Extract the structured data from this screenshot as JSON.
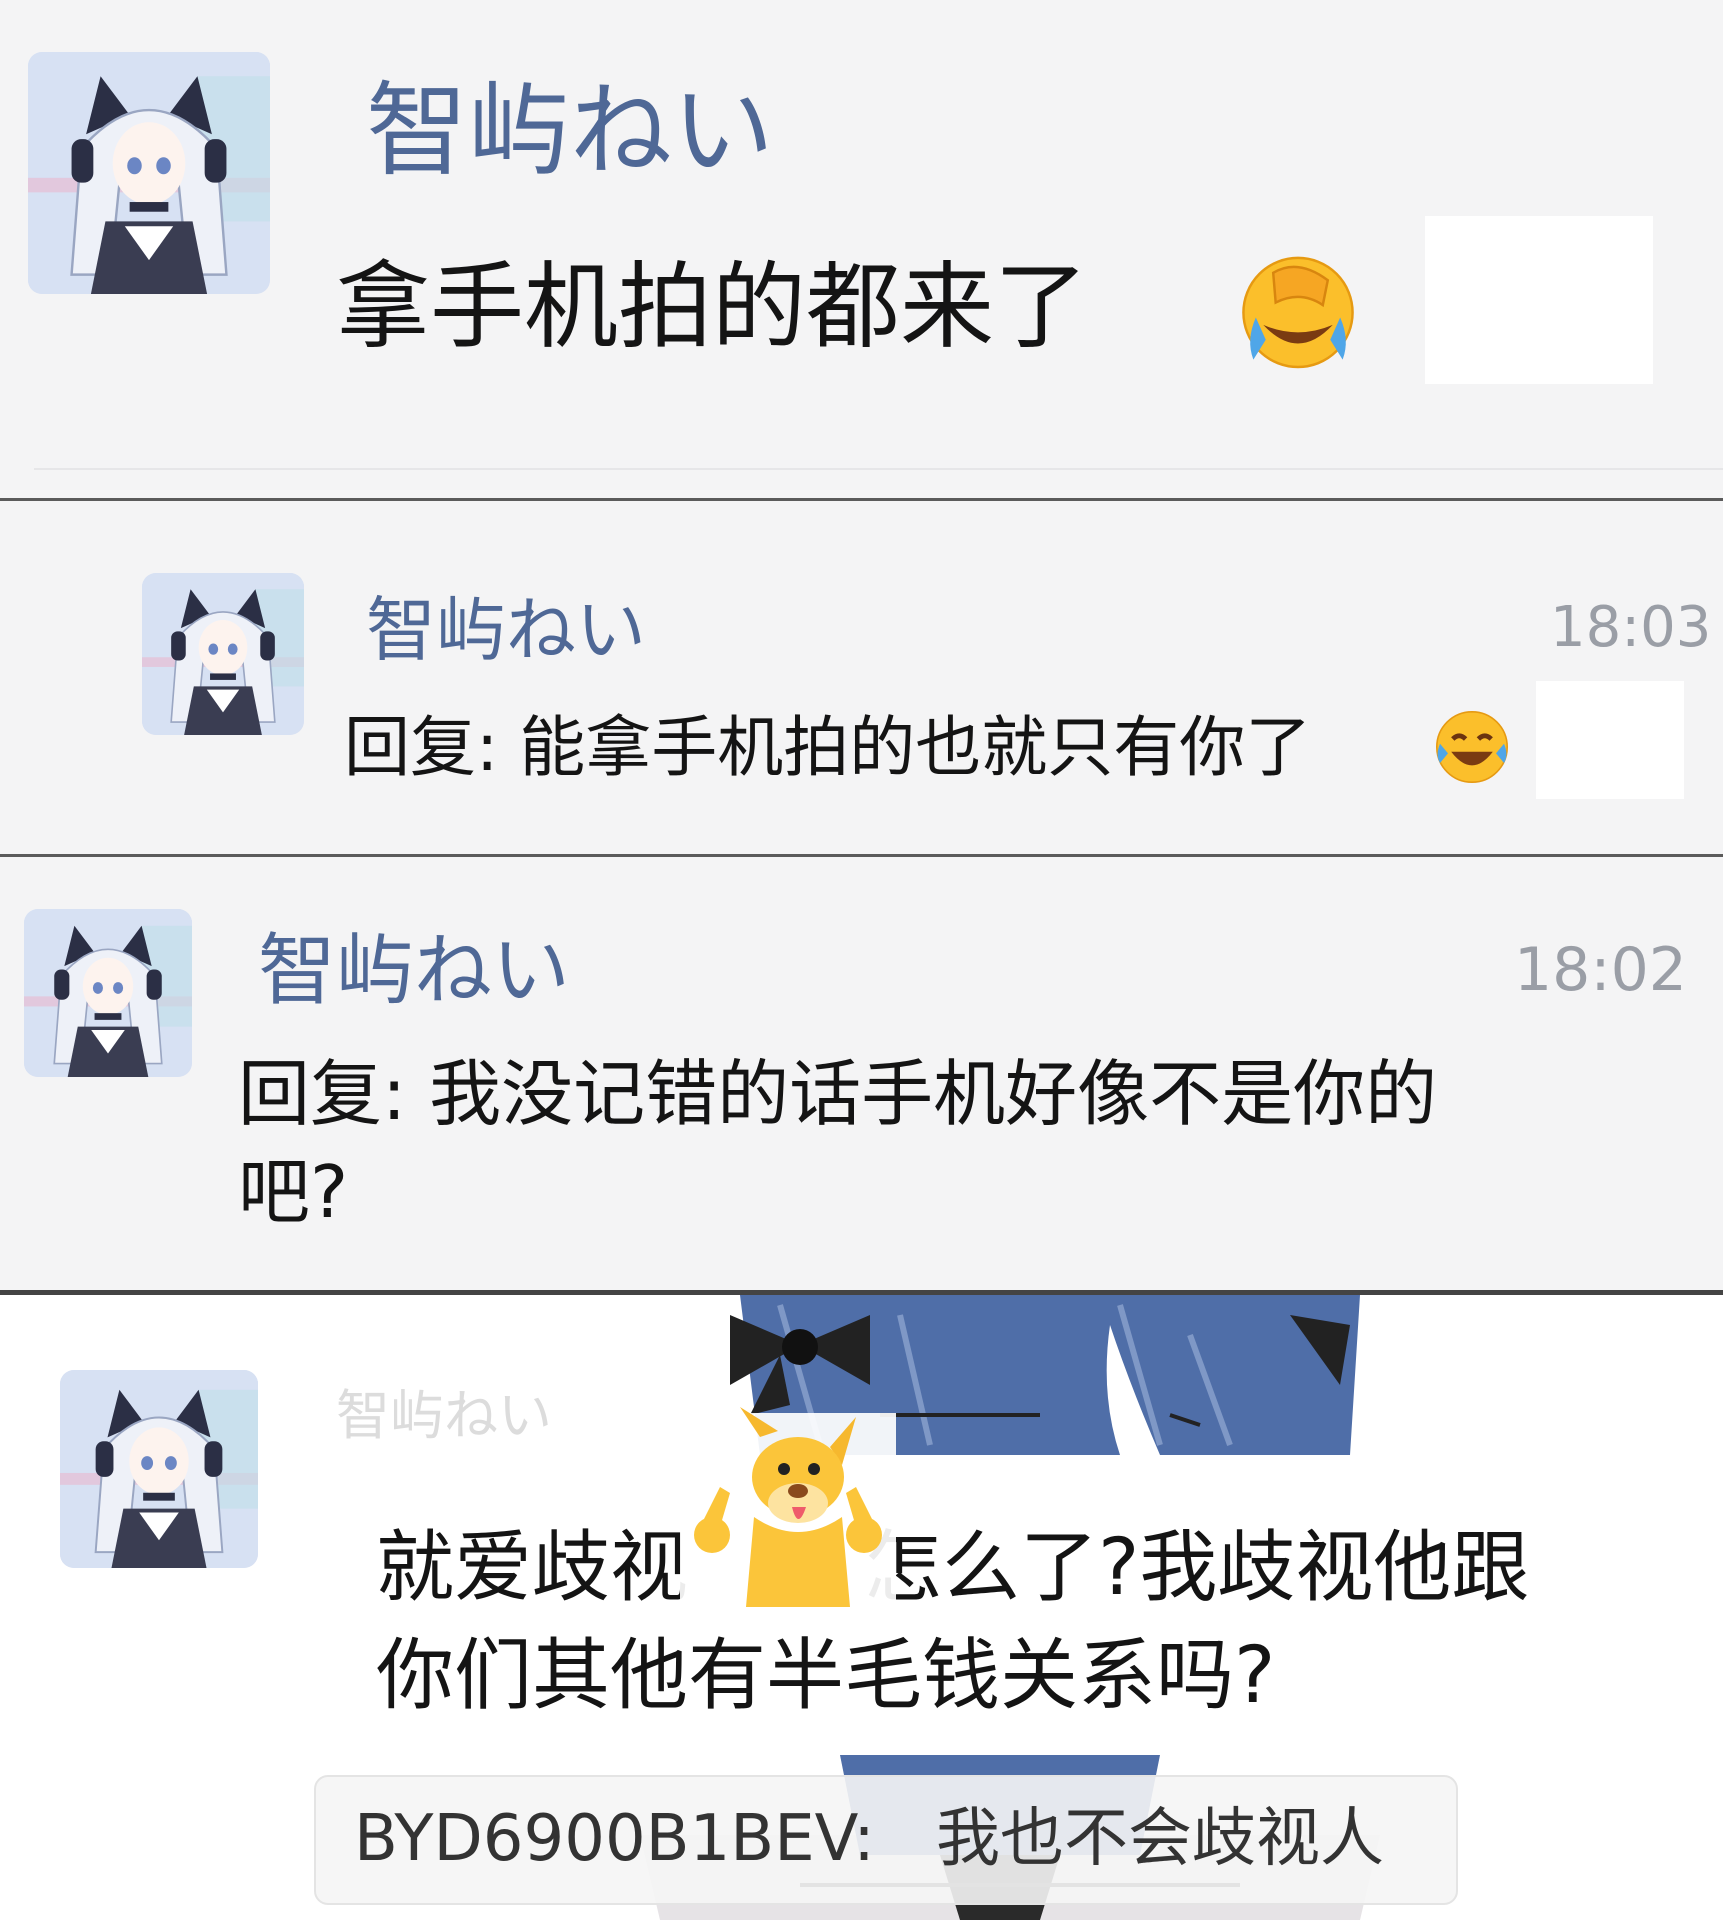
{
  "posts": [
    {
      "name": "智屿ねい",
      "text": "拿手机拍的都来了"
    },
    {
      "name": "智屿ねい",
      "time": "18:03",
      "text": "回复: 能拿手机拍的也就只有你了"
    },
    {
      "name": "智屿ねい",
      "time": "18:02",
      "text_line1": "回复: 我没记错的话手机好像不是你的",
      "text_line2": "吧?"
    },
    {
      "name": "智屿ねい",
      "text_line1_a": "就爱歧视",
      "text_line1_b": "怎么了?我歧视他跟",
      "text_line2": "你们其他有半毛钱关系吗?"
    }
  ],
  "danmaku": {
    "user": "BYD6900B1BEV:",
    "text": "我也不会歧视人"
  },
  "icons": [
    "facepalm-laugh-emoji-icon",
    "tears-of-joy-emoji-icon",
    "dog-sticker-icon",
    "avatar-icon"
  ],
  "colors": {
    "name": "#4f6896",
    "text": "#141414",
    "time": "#9a9ea6",
    "background": "#f4f4f5"
  }
}
